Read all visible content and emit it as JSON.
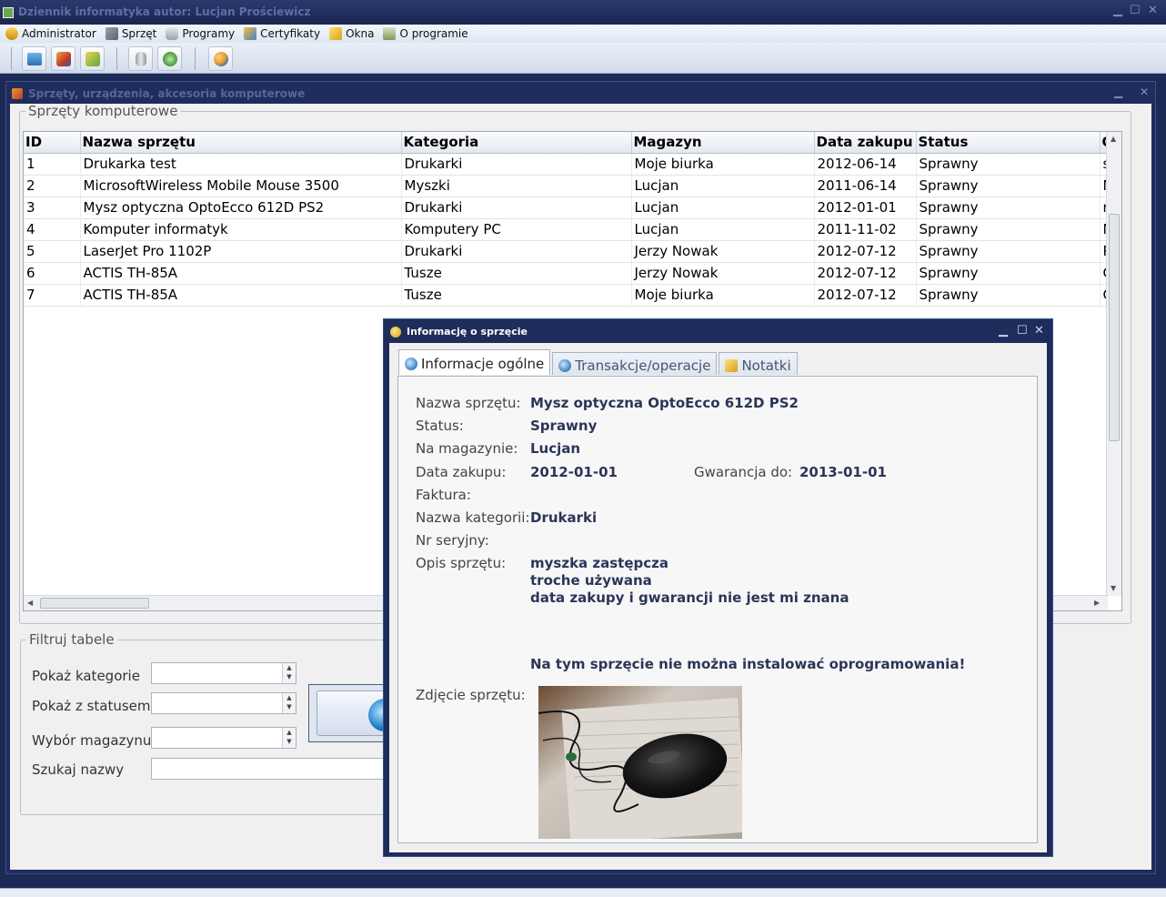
{
  "app": {
    "title": "Dziennik informatyka autor: Lucjan Prościewicz",
    "menu": [
      {
        "label": "Administrator",
        "icon": "admin-icon"
      },
      {
        "label": "Sprzęt",
        "icon": "tools-icon"
      },
      {
        "label": "Programy",
        "icon": "database-icon"
      },
      {
        "label": "Certyfikaty",
        "icon": "certificate-icon"
      },
      {
        "label": "Okna",
        "icon": "windows-icon"
      },
      {
        "label": "O programie",
        "icon": "about-icon"
      }
    ]
  },
  "child_window": {
    "title": "Sprzęty, urządzenia, akcesoria komputerowe",
    "group_title": "Sprzęty komputerowe",
    "columns": [
      "ID",
      "Nazwa sprzętu",
      "Kategoria",
      "Magazyn",
      "Data zakupu",
      "Status",
      "O"
    ],
    "rows": [
      [
        "1",
        "Drukarka test",
        "Drukarki",
        "Moje biurka",
        "2012-06-14",
        "Sprawny",
        "s"
      ],
      [
        "2",
        "MicrosoftWireless Mobile Mouse 3500",
        "Myszki",
        "Lucjan",
        "2011-06-14",
        "Sprawny",
        "M"
      ],
      [
        "3",
        "Mysz optyczna OptoEcco 612D PS2",
        "Drukarki",
        "Lucjan",
        "2012-01-01",
        "Sprawny",
        "r"
      ],
      [
        "4",
        "Komputer informatyk",
        "Komputery PC",
        "Lucjan",
        "2011-11-02",
        "Sprawny",
        "M"
      ],
      [
        "5",
        "LaserJet Pro 1102P",
        "Drukarki",
        "Jerzy Nowak",
        "2012-07-12",
        "Sprawny",
        "P"
      ],
      [
        "6",
        "ACTIS TH-85A",
        "Tusze",
        "Jerzy Nowak",
        "2012-07-12",
        "Sprawny",
        "C"
      ],
      [
        "7",
        "ACTIS TH-85A",
        "Tusze",
        "Moje biurka",
        "2012-07-12",
        "Sprawny",
        "C"
      ]
    ],
    "filter": {
      "title": "Filtruj tabele",
      "category_label": "Pokaż kategorie",
      "status_label": "Pokaż z statusem",
      "warehouse_label": "Wybór magazynu",
      "search_label": "Szukaj nazwy"
    }
  },
  "dialog": {
    "title": "Informację o sprzęcie",
    "tabs": [
      "Informacje ogólne",
      "Transakcje/operacje",
      "Notatki"
    ],
    "name_label": "Nazwa sprzętu:",
    "name_value": "Mysz optyczna OptoEcco 612D PS2",
    "status_label": "Status:",
    "status_value": "Sprawny",
    "warehouse_label": "Na magazynie:",
    "warehouse_value": "Lucjan",
    "purchase_label": "Data zakupu:",
    "purchase_value": "2012-01-01",
    "warranty_label": "Gwarancja do:",
    "warranty_value": "2013-01-01",
    "invoice_label": "Faktura:",
    "category_label": "Nazwa kategorii:",
    "category_value": "Drukarki",
    "serial_label": "Nr seryjny:",
    "description_label": "Opis sprzętu:",
    "description_lines": [
      "myszka zastępcza",
      "troche używana",
      "data zakupy i gwarancji nie jest mi znana"
    ],
    "warning": "Na tym sprzęcie nie można instalować oprogramowania!",
    "photo_label": "Zdjęcie sprzętu:"
  }
}
